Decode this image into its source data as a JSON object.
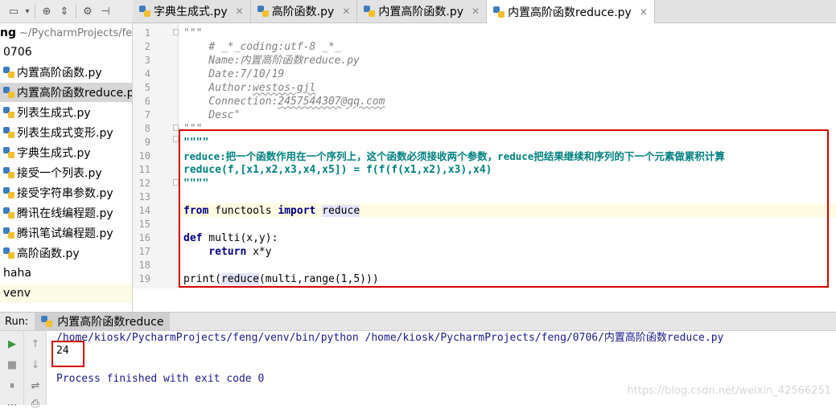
{
  "project": {
    "root_name": "ng",
    "root_path": "~/PycharmProjects/fe",
    "items": [
      {
        "label": "0706",
        "icon": "",
        "state": ""
      },
      {
        "label": "内置高阶函数.py",
        "icon": "python-file-icon",
        "state": ""
      },
      {
        "label": "内置高阶函数reduce.p",
        "icon": "python-file-icon",
        "state": "selected"
      },
      {
        "label": "列表生成式.py",
        "icon": "python-file-icon",
        "state": ""
      },
      {
        "label": "列表生成式变形.py",
        "icon": "python-file-icon",
        "state": ""
      },
      {
        "label": "字典生成式.py",
        "icon": "python-file-icon",
        "state": ""
      },
      {
        "label": "接受一个列表.py",
        "icon": "python-file-icon",
        "state": ""
      },
      {
        "label": "接受字符串参数.py",
        "icon": "python-file-icon",
        "state": ""
      },
      {
        "label": "腾讯在线编程题.py",
        "icon": "python-file-icon",
        "state": ""
      },
      {
        "label": "腾讯笔试编程题.py",
        "icon": "python-file-icon",
        "state": ""
      },
      {
        "label": "高阶函数.py",
        "icon": "python-file-icon",
        "state": ""
      },
      {
        "label": "haha",
        "icon": "",
        "state": ""
      },
      {
        "label": "venv",
        "icon": "",
        "state": "highlight"
      }
    ]
  },
  "tabs": [
    {
      "label": "字典生成式.py",
      "active": false
    },
    {
      "label": "高阶函数.py",
      "active": false
    },
    {
      "label": "内置高阶函数.py",
      "active": false
    },
    {
      "label": "内置高阶函数reduce.py",
      "active": true
    }
  ],
  "tab_close_glyph": "✕",
  "editor": {
    "line_numbers": [
      "1",
      "2",
      "3",
      "4",
      "5",
      "6",
      "7",
      "8",
      "9",
      "10",
      "11",
      "12",
      "13",
      "14",
      "15",
      "16",
      "17",
      "18",
      "19"
    ],
    "lines": {
      "l1": "\"\"\"",
      "l2": "    # _*_coding:utf-8 _*_",
      "l3": "    Name:内置高阶函数reduce.py",
      "l4": "    Date:7/10/19",
      "l5a": "    Author:",
      "l5b": "westos-gjl",
      "l6a": "    Connection:",
      "l6b": "2457544307@qq.com",
      "l7": "    Desc\"",
      "l8": "\"\"\"",
      "l9": "\"\"\"\"",
      "l10": "reduce:把一个函数作用在一个序列上，这个函数必须接收两个参数，reduce把结果继续和序列的下一个元素做累积计算",
      "l11": "reduce(f,[x1,x2,x3,x4,x5]) = f(f(f(x1,x2),x3),x4)",
      "l12": "\"\"\"\"",
      "l14_kw1": "from",
      "l14_mid": " functools ",
      "l14_kw2": "import",
      "l14_sp": " ",
      "l14_name": "reduce",
      "l16_kw": "def",
      "l16_rest": " multi(x,y):",
      "l17_kw": "    return",
      "l17_rest": " x*y",
      "l19_a": "print(",
      "l19_b": "reduce",
      "l19_c": "(multi,range(1,5)))"
    }
  },
  "run": {
    "label": "Run:",
    "config": "内置高阶函数reduce",
    "command": "/home/kiosk/PycharmProjects/feng/venv/bin/python /home/kiosk/PycharmProjects/feng/0706/内置高阶函数reduce.py",
    "output": "24",
    "exit_message": "Process finished with exit code 0"
  },
  "watermark": "https://blog.csdn.net/weixin_42566251",
  "colors": {
    "highlight_box": "#d40000",
    "keyword": "#000080",
    "docstring": "#008080",
    "comment": "#808080"
  }
}
